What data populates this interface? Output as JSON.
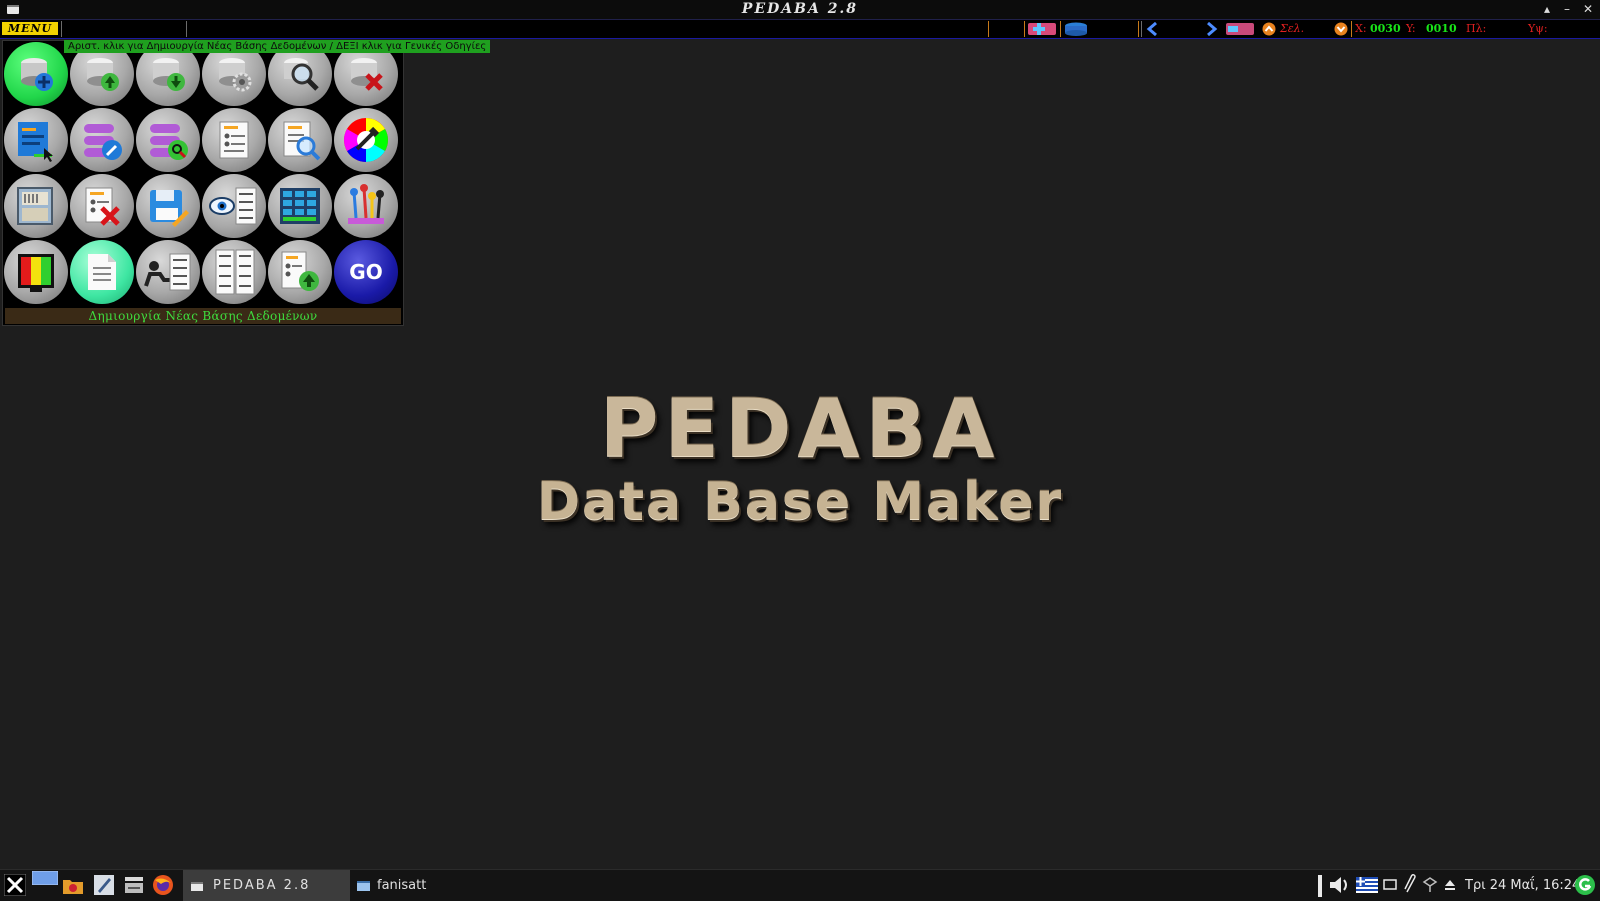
{
  "window": {
    "title": "PEDABA 2.8",
    "controls": [
      "▴",
      "–",
      "✕"
    ]
  },
  "toolbar": {
    "menu_label": "MENU",
    "sel_label": "Σελ.",
    "x_label": "X:",
    "x_value": "0030",
    "y_label": "Y:",
    "y_value": "0010",
    "width_label": "Πλ:",
    "height_label": "Υψ:"
  },
  "menu_panel": {
    "hint": "Αριστ. κλικ για Δημιουργία Νέας Βάσης Δεδομένων / ΔΕΞΙ κλικ για Γενικές Οδηγίες",
    "status": "Δημιουργία Νέας Βάσης Δεδομένων",
    "go_label": "GO",
    "buttons": [
      {
        "icon": "create-database-icon",
        "active": true
      },
      {
        "icon": "open-database-icon"
      },
      {
        "icon": "save-database-icon"
      },
      {
        "icon": "database-settings-icon"
      },
      {
        "icon": "search-database-icon"
      },
      {
        "icon": "delete-database-icon"
      },
      {
        "icon": "form-designer-icon"
      },
      {
        "icon": "edit-fields-icon"
      },
      {
        "icon": "search-fields-icon"
      },
      {
        "icon": "record-card-icon"
      },
      {
        "icon": "record-search-icon"
      },
      {
        "icon": "color-picker-icon"
      },
      {
        "icon": "file-cabinet-icon"
      },
      {
        "icon": "delete-record-icon"
      },
      {
        "icon": "save-record-icon"
      },
      {
        "icon": "view-list-icon"
      },
      {
        "icon": "table-grid-icon"
      },
      {
        "icon": "pushpins-icon"
      },
      {
        "icon": "traffic-light-icon"
      },
      {
        "icon": "document-icon"
      },
      {
        "icon": "report-icon"
      },
      {
        "icon": "abcd-list-icon"
      },
      {
        "icon": "upload-record-icon"
      },
      {
        "icon": "go-icon"
      }
    ]
  },
  "logo": {
    "title": "PEDABA",
    "subtitle": "Data Base Maker"
  },
  "taskbar": {
    "task1": "PEDABA 2.8",
    "task2": "fanisatt",
    "clock": "Τρι 24 Μαΐ, 16:24"
  }
}
